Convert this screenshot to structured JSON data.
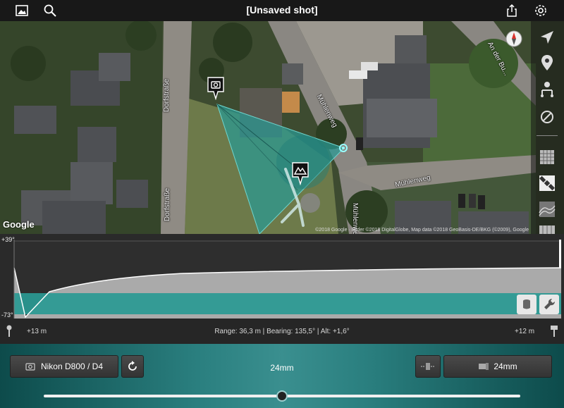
{
  "header": {
    "title": "[Unsaved shot]"
  },
  "map": {
    "streets": [
      "Dorfstraße",
      "Dorfstraße",
      "Mühlenweg",
      "Mühlenweg",
      "Mühlenweg",
      "An der Bu..."
    ],
    "google_label": "Google",
    "attribution": "©2018 Google · Bilder ©2018 DigitalGlobe, Map data ©2018 GeoBasis-DE/BKG (©2009), Google"
  },
  "elevation": {
    "top_label": "+39°",
    "bottom_label": "-73°"
  },
  "info": {
    "left_distance": "+13 m",
    "center_text": "Range: 36,3 m | Bearing: 135,5° | Alt: +1,6°",
    "right_distance": "+12 m"
  },
  "controls": {
    "camera_label": "Nikon D800 / D4",
    "focal_display": "24mm",
    "lens_label": "24mm",
    "zoom_level": 0.5
  },
  "colors": {
    "teal": "#2a9a94",
    "panel_teal": "#2a7f7f"
  }
}
